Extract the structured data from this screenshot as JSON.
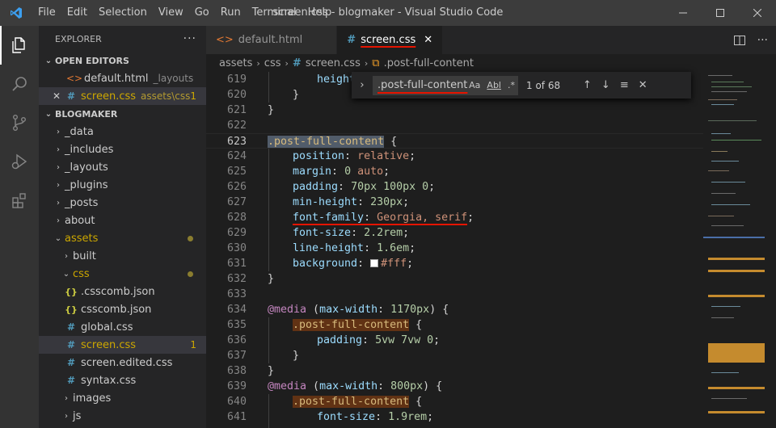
{
  "titlebar": {
    "menu": [
      "File",
      "Edit",
      "Selection",
      "View",
      "Go",
      "Run",
      "Terminal",
      "Help"
    ],
    "title": "screen.css - blogmaker - Visual Studio Code"
  },
  "activitybar": [
    "files-icon",
    "search-icon",
    "source-control-icon",
    "run-debug-icon",
    "extensions-icon"
  ],
  "sidebar": {
    "header": "EXPLORER",
    "more": "···",
    "open_editors": {
      "label": "OPEN EDITORS",
      "items": [
        {
          "name": "default.html",
          "desc": "_layouts",
          "icon": "html-file-icon"
        },
        {
          "name": "screen.css",
          "desc": "assets\\css",
          "badge": "1",
          "icon": "css-file-icon"
        }
      ]
    },
    "project": {
      "label": "BLOGMAKER",
      "tree": [
        {
          "name": "_data",
          "type": "folder"
        },
        {
          "name": "_includes",
          "type": "folder"
        },
        {
          "name": "_layouts",
          "type": "folder"
        },
        {
          "name": "_plugins",
          "type": "folder"
        },
        {
          "name": "_posts",
          "type": "folder"
        },
        {
          "name": "about",
          "type": "folder"
        },
        {
          "name": "assets",
          "type": "folder-open"
        },
        {
          "name": "built",
          "type": "folder"
        },
        {
          "name": "css",
          "type": "folder-open"
        },
        {
          "name": ".csscomb.json",
          "type": "json"
        },
        {
          "name": "csscomb.json",
          "type": "json"
        },
        {
          "name": "global.css",
          "type": "css"
        },
        {
          "name": "screen.css",
          "type": "css",
          "badge": "1"
        },
        {
          "name": "screen.edited.css",
          "type": "css"
        },
        {
          "name": "syntax.css",
          "type": "css"
        },
        {
          "name": "images",
          "type": "folder"
        },
        {
          "name": "js",
          "type": "folder"
        }
      ]
    }
  },
  "tabs": [
    {
      "label": "default.html",
      "active": false
    },
    {
      "label": "screen.css",
      "active": true
    }
  ],
  "breadcrumbs": [
    "assets",
    "css",
    "screen.css",
    ".post-full-content"
  ],
  "find": {
    "value": ".post-full-content",
    "opt_case": "Aa",
    "opt_word": "Abl",
    "opt_regex": ".*",
    "count": "1 of 68"
  },
  "code": {
    "line_numbers": [
      "619",
      "620",
      "621",
      "622",
      "623",
      "624",
      "625",
      "626",
      "627",
      "628",
      "629",
      "630",
      "631",
      "632",
      "633",
      "634",
      "635",
      "636",
      "637",
      "638",
      "639",
      "640",
      "641"
    ],
    "lines": {
      "l619_prop": "height",
      "l620": "}",
      "l621": "}",
      "l623_sel": ".post-full-content",
      "l623_brace": " {",
      "l624_prop": "position",
      "l624_val": "relative",
      "l625_prop": "margin",
      "l625_num": "0",
      "l625_val": "auto",
      "l626_prop": "padding",
      "l626_num": "70px 100px 0",
      "l627_prop": "min-height",
      "l627_num": "230px",
      "l628_prop": "font-family",
      "l628_val": "Georgia, serif",
      "l629_prop": "font-size",
      "l629_num": "2.2rem",
      "l630_prop": "line-height",
      "l630_num": "1.6em",
      "l631_prop": "background",
      "l631_val": "#fff",
      "l632": "}",
      "l634_kw": "@media",
      "l634_prop": "max-width",
      "l634_num": "1170px",
      "l635_sel": ".post-full-content",
      "l636_prop": "padding",
      "l636_num": "5vw 7vw 0",
      "l637": "}",
      "l638": "}",
      "l639_kw": "@media",
      "l639_prop": "max-width",
      "l639_num": "800px",
      "l640_sel": ".post-full-content",
      "l641_prop": "font-size",
      "l641_num": "1.9rem"
    }
  }
}
